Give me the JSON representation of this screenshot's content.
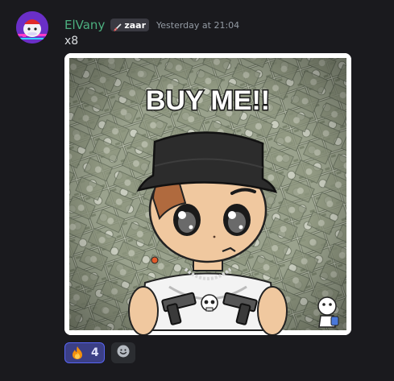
{
  "message": {
    "author": {
      "username": "ElVany",
      "username_color": "#4caf7f",
      "server_tag": {
        "label": "zaar",
        "icon": "sword-icon"
      }
    },
    "timestamp": "Yesterday at 21:04",
    "content": "x8",
    "attachment": {
      "type": "image",
      "caption": "BUY ME!!"
    },
    "reactions": [
      {
        "emoji": "fire-emoji",
        "count": "4",
        "active": true
      }
    ],
    "add_reaction": {
      "icon": "smiley-icon"
    }
  },
  "colors": {
    "background": "#1a1a1e",
    "reaction_active_bg": "#3b3f86",
    "reaction_active_border": "#5865f2",
    "timestamp": "#949ba4"
  }
}
